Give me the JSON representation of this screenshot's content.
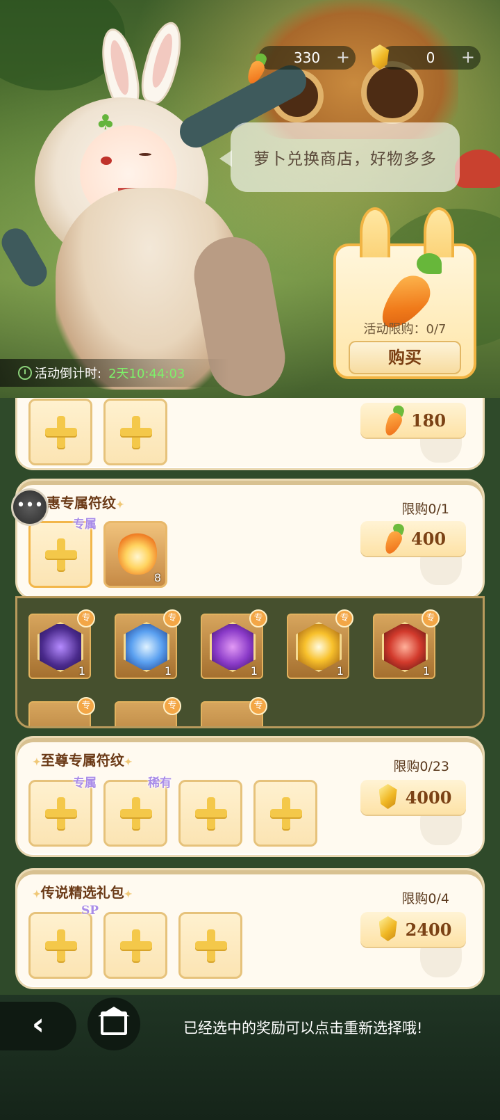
{
  "currency": {
    "carrot_amount": "330",
    "gem_amount": "0",
    "plus": "+"
  },
  "banner": {
    "speech": "萝卜兑换商店，好物多多",
    "feature_limit": "活动限购：0/7",
    "buy_label": "购买",
    "countdown_label": "活动倒计时:",
    "countdown_value": "2天10:44:03"
  },
  "cards": {
    "first": {
      "price": "180"
    },
    "special": {
      "title": "特惠专属符纹",
      "tag": "专属",
      "limit": "限购0/1",
      "price": "400",
      "item_count": "8"
    },
    "special_pool": {
      "counts": [
        "1",
        "1",
        "1",
        "1",
        "1"
      ],
      "badge": "专"
    },
    "supreme": {
      "title": "至尊专属符纹",
      "tags": [
        "专属",
        "稀有"
      ],
      "limit": "限购0/23",
      "price": "4000"
    },
    "legend": {
      "title": "传说精选礼包",
      "tag": "SP",
      "limit": "限购0/4",
      "price": "2400"
    }
  },
  "bottom": {
    "hint": "已经选中的奖励可以点击重新选择哦!"
  },
  "icons": {
    "back": "‹",
    "chat": "•••"
  },
  "colors": {
    "accent_gold": "#f1b443",
    "timer_green": "#7ef06a",
    "tag_purple": "#a98ce8"
  }
}
